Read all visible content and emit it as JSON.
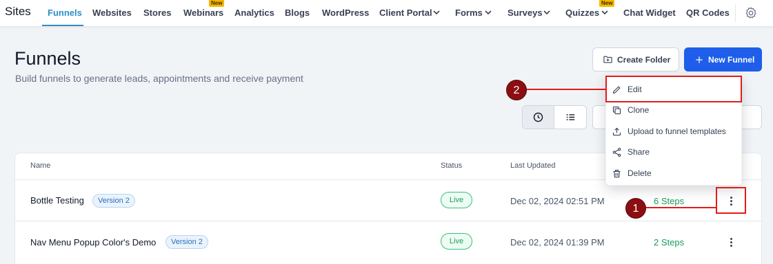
{
  "nav": {
    "brand": "Sites",
    "items": [
      {
        "label": "Funnels"
      },
      {
        "label": "Websites"
      },
      {
        "label": "Stores"
      },
      {
        "label": "Webinars",
        "badge": "New"
      },
      {
        "label": "Analytics"
      },
      {
        "label": "Blogs"
      },
      {
        "label": "WordPress"
      },
      {
        "label": "Client Portal"
      },
      {
        "label": "Forms"
      },
      {
        "label": "Surveys"
      },
      {
        "label": "Quizzes",
        "badge": "New"
      },
      {
        "label": "Chat Widget"
      },
      {
        "label": "QR Codes"
      }
    ],
    "settings_icon": "gear-icon"
  },
  "header": {
    "title": "Funnels",
    "subtitle": "Build funnels to generate leads, appointments and receive payment",
    "create_folder_label": "Create Folder",
    "new_funnel_label": "New Funnel"
  },
  "table": {
    "columns": [
      "Name",
      "Status",
      "Last Updated"
    ],
    "rows": [
      {
        "name": "Bottle Testing",
        "version": "Version 2",
        "status": "Live",
        "updated": "Dec 02, 2024 02:51 PM",
        "steps": "6 Steps"
      },
      {
        "name": "Nav Menu Popup Color's Demo",
        "version": "Version 2",
        "status": "Live",
        "updated": "Dec 02, 2024 01:39 PM",
        "steps": "2 Steps"
      }
    ]
  },
  "menu": {
    "items": [
      {
        "label": "Edit",
        "icon": "pencil-icon"
      },
      {
        "label": "Clone",
        "icon": "copy-icon"
      },
      {
        "label": "Upload to funnel templates",
        "icon": "upload-icon"
      },
      {
        "label": "Share",
        "icon": "share-icon"
      },
      {
        "label": "Delete",
        "icon": "trash-icon"
      }
    ]
  },
  "annotations": {
    "first": "1",
    "second": "2"
  },
  "colors": {
    "accent": "#2b8fc9",
    "primary": "#1e5eea",
    "live": "#1c9a57",
    "annotation": "#e11b1b"
  }
}
